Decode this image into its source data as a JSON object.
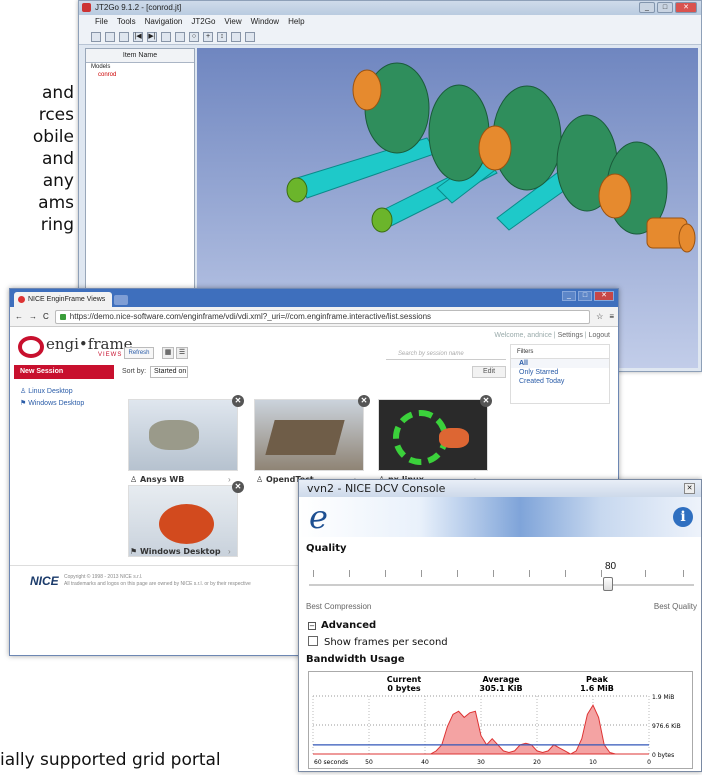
{
  "background": {
    "lines": [
      "and",
      "rces",
      "obile",
      "and",
      "any",
      "ams",
      "ring"
    ],
    "bottom": "ially supported grid portal"
  },
  "jt": {
    "title": "JT2Go 9.1.2 - [conrod.jt]",
    "menu": [
      "File",
      "Tools",
      "Navigation",
      "JT2Go",
      "View",
      "Window",
      "Help"
    ],
    "tree_header": "Item Name",
    "tree": [
      "Models",
      "conrod"
    ]
  },
  "browser": {
    "tab": "NICE EnginFrame Views",
    "url": "https://demo.nice-software.com/enginframe/vdi/vdi.xml?_uri=//com.enginframe.interactive/list.sessions",
    "user_links": {
      "welcome": "Welcome, andnice",
      "settings": "Settings",
      "logout": "Logout"
    },
    "logo": {
      "text": "engi•frame",
      "sub": "VIEWS"
    },
    "new_session": "New Session",
    "desktops": [
      "Linux Desktop",
      "Windows Desktop"
    ],
    "refresh": "Refresh",
    "sort_label": "Sort by:",
    "sort_value": "Started on",
    "search_placeholder": "Search by session name",
    "edit": "Edit",
    "filters": {
      "header": "Filters",
      "items": [
        "All",
        "Only Starred",
        "Created Today"
      ]
    },
    "sessions": [
      "Ansys WB",
      "OpendTect",
      "nx.linux",
      "Windows Desktop"
    ],
    "footer": {
      "logo": "NICE",
      "copyright": "Copyright © 1998 - 2013 NICE s.r.l.",
      "trademark": "All trademarks and logos on this page are owned by NICE s.r.l. or by their respective"
    }
  },
  "dcv": {
    "title": "vvn2 - NICE DCV Console",
    "logo": "e",
    "quality_label": "Quality",
    "quality_value": "80",
    "best_compression": "Best Compression",
    "best_quality": "Best Quality",
    "advanced": "Advanced",
    "show_fps": "Show frames per second",
    "bandwidth_label": "Bandwidth Usage",
    "stats": [
      {
        "label": "Current",
        "value": "0 bytes"
      },
      {
        "label": "Average",
        "value": "305.1 KiB"
      },
      {
        "label": "Peak",
        "value": "1.6 MiB"
      }
    ]
  },
  "chart_data": {
    "type": "area",
    "y_tick_labels": [
      "1.9 MiB",
      "976.6 KiB",
      "0 bytes"
    ],
    "x_tick_labels": [
      "60 seconds",
      "50",
      "40",
      "30",
      "20",
      "10",
      "0"
    ],
    "series": [
      {
        "values": [
          0,
          0,
          0,
          0,
          0,
          0,
          0,
          0,
          0,
          0,
          0,
          0,
          0,
          0,
          0,
          0,
          0,
          0,
          0,
          0,
          0,
          0,
          0.1,
          0.3,
          0.9,
          1.3,
          1.4,
          1.2,
          1.35,
          1.4,
          0.6,
          0.3,
          0.5,
          0.3,
          0.1,
          0.05,
          0.1,
          0.3,
          0.35,
          0.3,
          0.1,
          0.05,
          0.1,
          0.3,
          0.2,
          0.1,
          0,
          0.1,
          0.5,
          1.3,
          1.6,
          1.2,
          0.3,
          0.05,
          0,
          0,
          0,
          0,
          0,
          0,
          0
        ]
      }
    ],
    "average_line": 0.3
  }
}
